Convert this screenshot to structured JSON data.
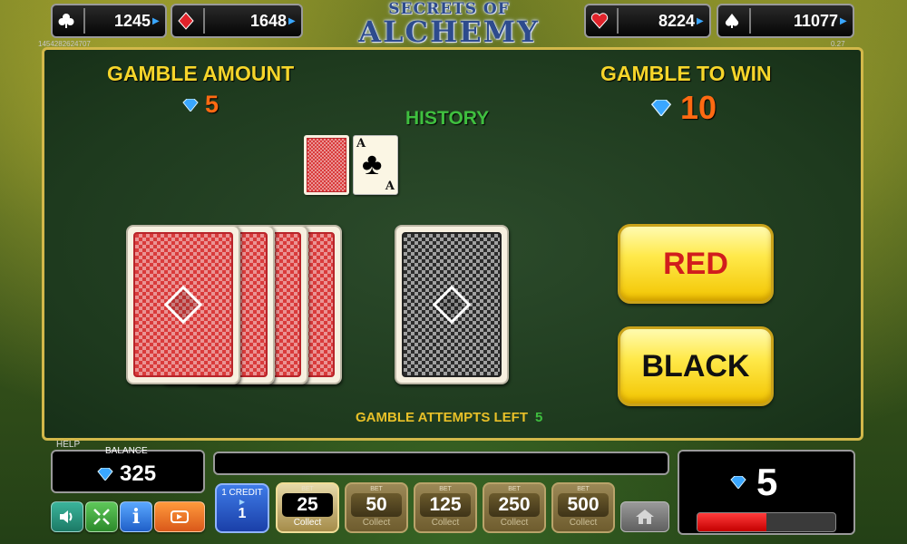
{
  "top_counters": [
    {
      "suit": "clubs",
      "value": "1245"
    },
    {
      "suit": "diamonds",
      "value": "1648"
    },
    {
      "suit": "hearts",
      "value": "8224"
    },
    {
      "suit": "spades",
      "value": "11077"
    }
  ],
  "logo": {
    "line1": "SECRETS OF",
    "line2": "ALCHEMY"
  },
  "tiny_left": "1454282624707",
  "tiny_right": "0.27",
  "gamble_amount": {
    "label": "GAMBLE AMOUNT",
    "value": "5"
  },
  "gamble_to_win": {
    "label": "GAMBLE TO WIN",
    "value": "10"
  },
  "history": {
    "label": "HISTORY",
    "face_rank": "A",
    "face_suit": "♣"
  },
  "buttons": {
    "red": "RED",
    "black": "BLACK"
  },
  "attempts": {
    "label": "GAMBLE ATTEMPTS LEFT",
    "value": "5"
  },
  "help_label": "HELP",
  "balance": {
    "label": "BALANCE",
    "value": "325"
  },
  "credit": {
    "label": "1 CREDIT",
    "value": "1"
  },
  "bets": [
    {
      "label": "BET",
      "value": "25",
      "sub": "Collect",
      "active": true
    },
    {
      "label": "BET",
      "value": "50",
      "sub": "Collect",
      "active": false
    },
    {
      "label": "BET",
      "value": "125",
      "sub": "Collect",
      "active": false
    },
    {
      "label": "BET",
      "value": "250",
      "sub": "Collect",
      "active": false
    },
    {
      "label": "BET",
      "value": "500",
      "sub": "Collect",
      "active": false
    }
  ],
  "win_display": {
    "value": "5",
    "progress": 0.5
  },
  "colors": {
    "panel_border": "#d2b84a",
    "label_yellow": "#f6d52a",
    "value_orange": "#ff6a12",
    "history_green": "#3fbf3f",
    "gem_blue": "#3aa7ff"
  },
  "icons": [
    "sound-icon",
    "fullscreen-icon",
    "info-icon",
    "autoplay-icon",
    "home-icon"
  ]
}
